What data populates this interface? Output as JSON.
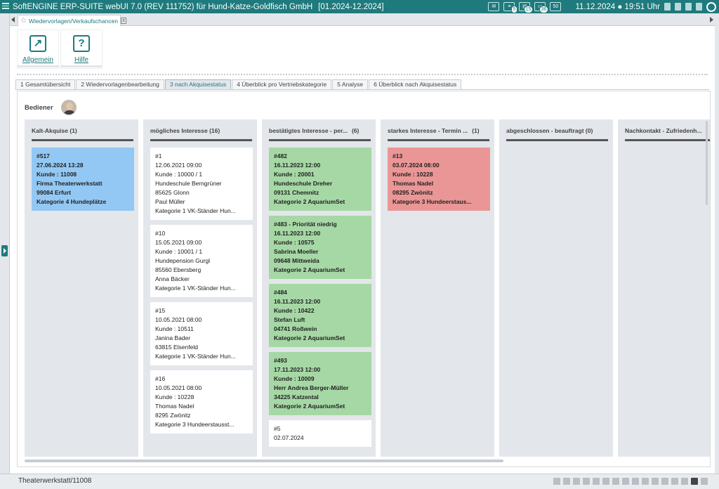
{
  "window": {
    "title": "SoftENGINE ERP-SUITE webUI 7.0 (REV 111752) für Hund-Katze-Goldfisch GmbH",
    "period": "[01.2024-12.2024]",
    "date": "11.12.2024",
    "time": "19:51 Uhr",
    "badges": [
      "5",
      "15",
      "36",
      "50"
    ]
  },
  "doc_tab": {
    "label": "Wiedervorlagen/Verkaufschancen",
    "close": "x"
  },
  "ribbon": [
    {
      "label": "Allgemein",
      "icon": "arrow-up-right-icon"
    },
    {
      "label": "Hilfe",
      "icon": "help-icon"
    }
  ],
  "subtabs": [
    "1 Gesamtübersicht",
    "2 Wiedervorlagenbearbeitung",
    "3 nach Akquisestatus",
    "4 Überblick pro Vertriebskategorie",
    "5 Analyse",
    "6 Überblick nach Akquisestatus"
  ],
  "active_subtab": 2,
  "bediener_label": "Bediener",
  "columns": [
    {
      "title": "Kalt-Akquise (1)",
      "cards": [
        {
          "color": "blue",
          "lines": [
            "#517",
            "27.06.2024 13:28",
            "Kunde : 11008",
            "Firma Theaterwerkstatt",
            "99084 Erfurt",
            "Kategorie 4 Hundeplätze"
          ]
        }
      ]
    },
    {
      "title": "mögliches Interesse (16)",
      "cards": [
        {
          "color": "white",
          "lines": [
            "#1",
            "12.06.2021 09:00",
            "Kunde : 10000 / 1",
            "Hundeschule Berngrüner",
            "85625 Glonn",
            "Paul Müller",
            "Kategorie 1 VK-Ständer Hun..."
          ]
        },
        {
          "color": "white",
          "lines": [
            "#10",
            "15.05.2021 09:00",
            "Kunde : 10001 / 1",
            "Hundepension Gurgl",
            "85560 Ebersberg",
            "Anna Bäcker",
            "Kategorie 1 VK-Ständer Hun..."
          ]
        },
        {
          "color": "white",
          "lines": [
            "#15",
            "10.05.2021 08:00",
            "Kunde : 10511",
            "Janina Bader",
            "63815 Elsenfeld",
            "Kategorie 1 VK-Ständer Hun..."
          ]
        },
        {
          "color": "white",
          "lines": [
            "#16",
            "10.05.2021 08:00",
            "Kunde : 10228",
            "Thomas Nadel",
            "8295 Zwönitz",
            "Kategorie 3 Hundeerstausst..."
          ]
        }
      ]
    },
    {
      "title": "bestätigtes Interesse - per...",
      "count": "(6)",
      "cards": [
        {
          "color": "green",
          "lines": [
            "#482",
            "16.11.2023 12:00",
            "Kunde : 20001",
            "Hundeschule Dreher",
            "09131 Chemnitz",
            "Kategorie 2 AquariumSet"
          ]
        },
        {
          "color": "green",
          "lines": [
            "#483 - Priorität niedrig",
            "16.11.2023 12:00",
            "Kunde : 10575",
            "Sabrina Moeller",
            "09648 Mittweida",
            "Kategorie 2 AquariumSet"
          ]
        },
        {
          "color": "green",
          "lines": [
            "#484",
            "16.11.2023 12:00",
            "Kunde : 10422",
            "Stefan Luft",
            "04741 Roßwein",
            "Kategorie 2 AquariumSet"
          ]
        },
        {
          "color": "green",
          "lines": [
            "#493",
            "17.11.2023 12:00",
            "Kunde : 10009",
            "Herr Andrea Berger-Müller",
            "34225 Katzental",
            "Kategorie 2 AquariumSet"
          ]
        },
        {
          "color": "white",
          "lines": [
            "#5",
            "02.07.2024"
          ]
        }
      ]
    },
    {
      "title": "starkes Interesse - Termin ...",
      "count": "(1)",
      "cards": [
        {
          "color": "red",
          "lines": [
            "#13",
            "03.07.2024 08:00",
            "Kunde : 10228",
            "Thomas Nadel",
            "08295 Zwönitz",
            "Kategorie 3 Hundeerstaus..."
          ]
        }
      ]
    },
    {
      "title": "abgeschlossen - beauftragt (0)",
      "cards": []
    },
    {
      "title": "Nachkontakt - Zufriedenh...",
      "cards": []
    }
  ],
  "status": {
    "text": "Theaterwerkstatt/11008"
  }
}
